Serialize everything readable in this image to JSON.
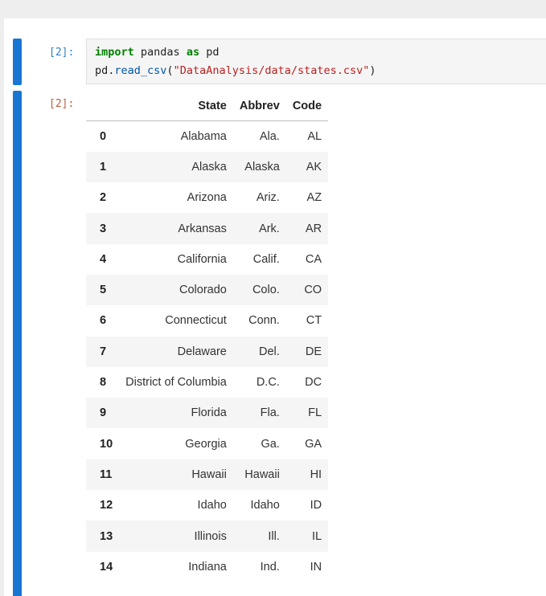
{
  "cell_in": {
    "prompt": "[2]:",
    "code": {
      "line1": {
        "kw_import": "import",
        "module": " pandas ",
        "kw_as": "as",
        "alias": " pd"
      },
      "line2": {
        "obj": "pd.",
        "func": "read_csv",
        "open": "(",
        "arg": "\"DataAnalysis/data/states.csv\"",
        "close": ")"
      }
    }
  },
  "cell_out": {
    "prompt": "[2]:",
    "table": {
      "columns": [
        "",
        "State",
        "Abbrev",
        "Code"
      ],
      "rows": [
        {
          "index": "0",
          "state": "Alabama",
          "abbrev": "Ala.",
          "code": "AL"
        },
        {
          "index": "1",
          "state": "Alaska",
          "abbrev": "Alaska",
          "code": "AK"
        },
        {
          "index": "2",
          "state": "Arizona",
          "abbrev": "Ariz.",
          "code": "AZ"
        },
        {
          "index": "3",
          "state": "Arkansas",
          "abbrev": "Ark.",
          "code": "AR"
        },
        {
          "index": "4",
          "state": "California",
          "abbrev": "Calif.",
          "code": "CA"
        },
        {
          "index": "5",
          "state": "Colorado",
          "abbrev": "Colo.",
          "code": "CO"
        },
        {
          "index": "6",
          "state": "Connecticut",
          "abbrev": "Conn.",
          "code": "CT"
        },
        {
          "index": "7",
          "state": "Delaware",
          "abbrev": "Del.",
          "code": "DE"
        },
        {
          "index": "8",
          "state": "District of Columbia",
          "abbrev": "D.C.",
          "code": "DC"
        },
        {
          "index": "9",
          "state": "Florida",
          "abbrev": "Fla.",
          "code": "FL"
        },
        {
          "index": "10",
          "state": "Georgia",
          "abbrev": "Ga.",
          "code": "GA"
        },
        {
          "index": "11",
          "state": "Hawaii",
          "abbrev": "Hawaii",
          "code": "HI"
        },
        {
          "index": "12",
          "state": "Idaho",
          "abbrev": "Idaho",
          "code": "ID"
        },
        {
          "index": "13",
          "state": "Illinois",
          "abbrev": "Ill.",
          "code": "IL"
        },
        {
          "index": "14",
          "state": "Indiana",
          "abbrev": "Ind.",
          "code": "IN"
        }
      ]
    }
  },
  "colors": {
    "cell_bar": "#1976d2",
    "prompt_in": "#307fc1",
    "prompt_out": "#bf5b3d",
    "keyword": "#008000",
    "string": "#ba2121"
  }
}
